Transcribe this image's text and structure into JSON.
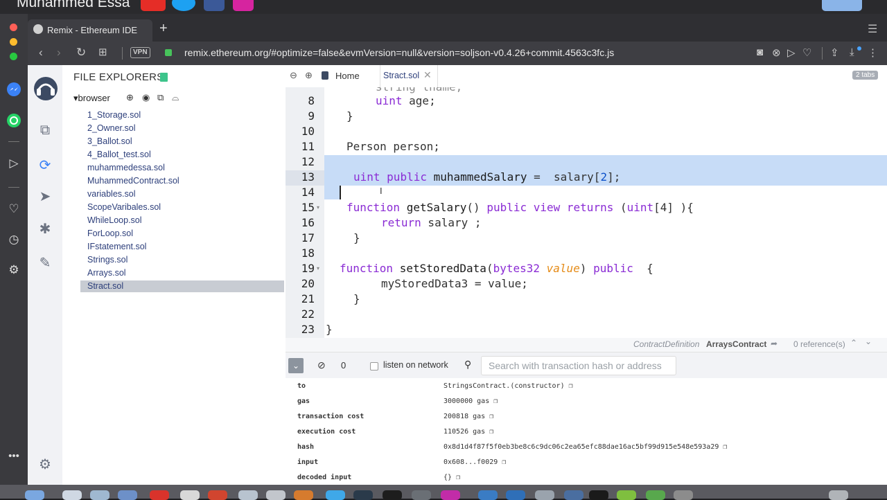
{
  "overlay": {
    "channel_name": "Muhammed Essa"
  },
  "browser": {
    "tab_title": "Remix - Ethereum IDE",
    "vpn_label": "VPN",
    "url": "remix.ethereum.org/#optimize=false&evmVersion=null&version=soljson-v0.4.26+commit.4563c3fc.js"
  },
  "explorer": {
    "title": "FILE EXPLORERS",
    "root": "browser",
    "files": [
      "1_Storage.sol",
      "2_Owner.sol",
      "3_Ballot.sol",
      "4_Ballot_test.sol",
      "muhammedessa.sol",
      "MuhammedContract.sol",
      "variables.sol",
      "ScopeVaribales.sol",
      "WhileLoop.sol",
      "ForLoop.sol",
      "IFstatement.sol",
      "Strings.sol",
      "Arrays.sol",
      "Stract.sol"
    ],
    "selected": "Stract.sol"
  },
  "editor": {
    "home_tab": "Home",
    "active_tab": "Stract.sol",
    "tabs_count": "2 tabs",
    "partial_line": "string lname;",
    "line_numbers": [
      "8",
      "9",
      "10",
      "11",
      "12",
      "13",
      "14",
      "15",
      "16",
      "17",
      "18",
      "19",
      "20",
      "21",
      "22",
      "23"
    ],
    "lines": {
      "l8_kw": "uint",
      "l8_rest": " age;",
      "l9": "}",
      "l11": "Person person;",
      "l13_kw1": "uint",
      "l13_kw2": "public",
      "l13_name": "muhammedSalary",
      "l13_eq": " =  salary[",
      "l13_num": "2",
      "l13_end": "];",
      "l15_kw": "function",
      "l15_name": "getSalary",
      "l15_mid": "() ",
      "l15_kw2": "public view returns",
      "l15_p": " (",
      "l15_kw3": "uint",
      "l15_rest": "[4] ){",
      "l16_kw": "return",
      "l16_rest": " salary ;",
      "l17": "}",
      "l19_kw": "function",
      "l19_name": "setStoredData",
      "l19_p": "(",
      "l19_kw2": "bytes32",
      "l19_param": "value",
      "l19_p2": ") ",
      "l19_kw3": "public",
      "l19_end": "  {",
      "l20": "myStoredData3 = value;",
      "l21": "}",
      "l23": "}"
    },
    "ref_kind": "ContractDefinition",
    "ref_name": "ArraysContract",
    "ref_count": "0 reference(s)"
  },
  "terminal": {
    "count": "0",
    "listen_label": "listen on network",
    "search_placeholder": "Search with transaction hash or address",
    "rows": [
      {
        "k": "to",
        "v": "StringsContract.(constructor)"
      },
      {
        "k": "gas",
        "v": "3000000 gas"
      },
      {
        "k": "transaction cost",
        "v": "200818 gas"
      },
      {
        "k": "execution cost",
        "v": "110526 gas"
      },
      {
        "k": "hash",
        "v": "0x8d1d4f87f5f0eb3be8c6c9dc06c2ea65efc88dae16ac5bf99d915e548e593a29"
      },
      {
        "k": "input",
        "v": "0x608...f0029"
      },
      {
        "k": "decoded input",
        "v": "{}"
      }
    ]
  },
  "colors": {
    "accent": "#c7dcf7",
    "keyword": "#8a2bd4",
    "param": "#e58b17"
  }
}
